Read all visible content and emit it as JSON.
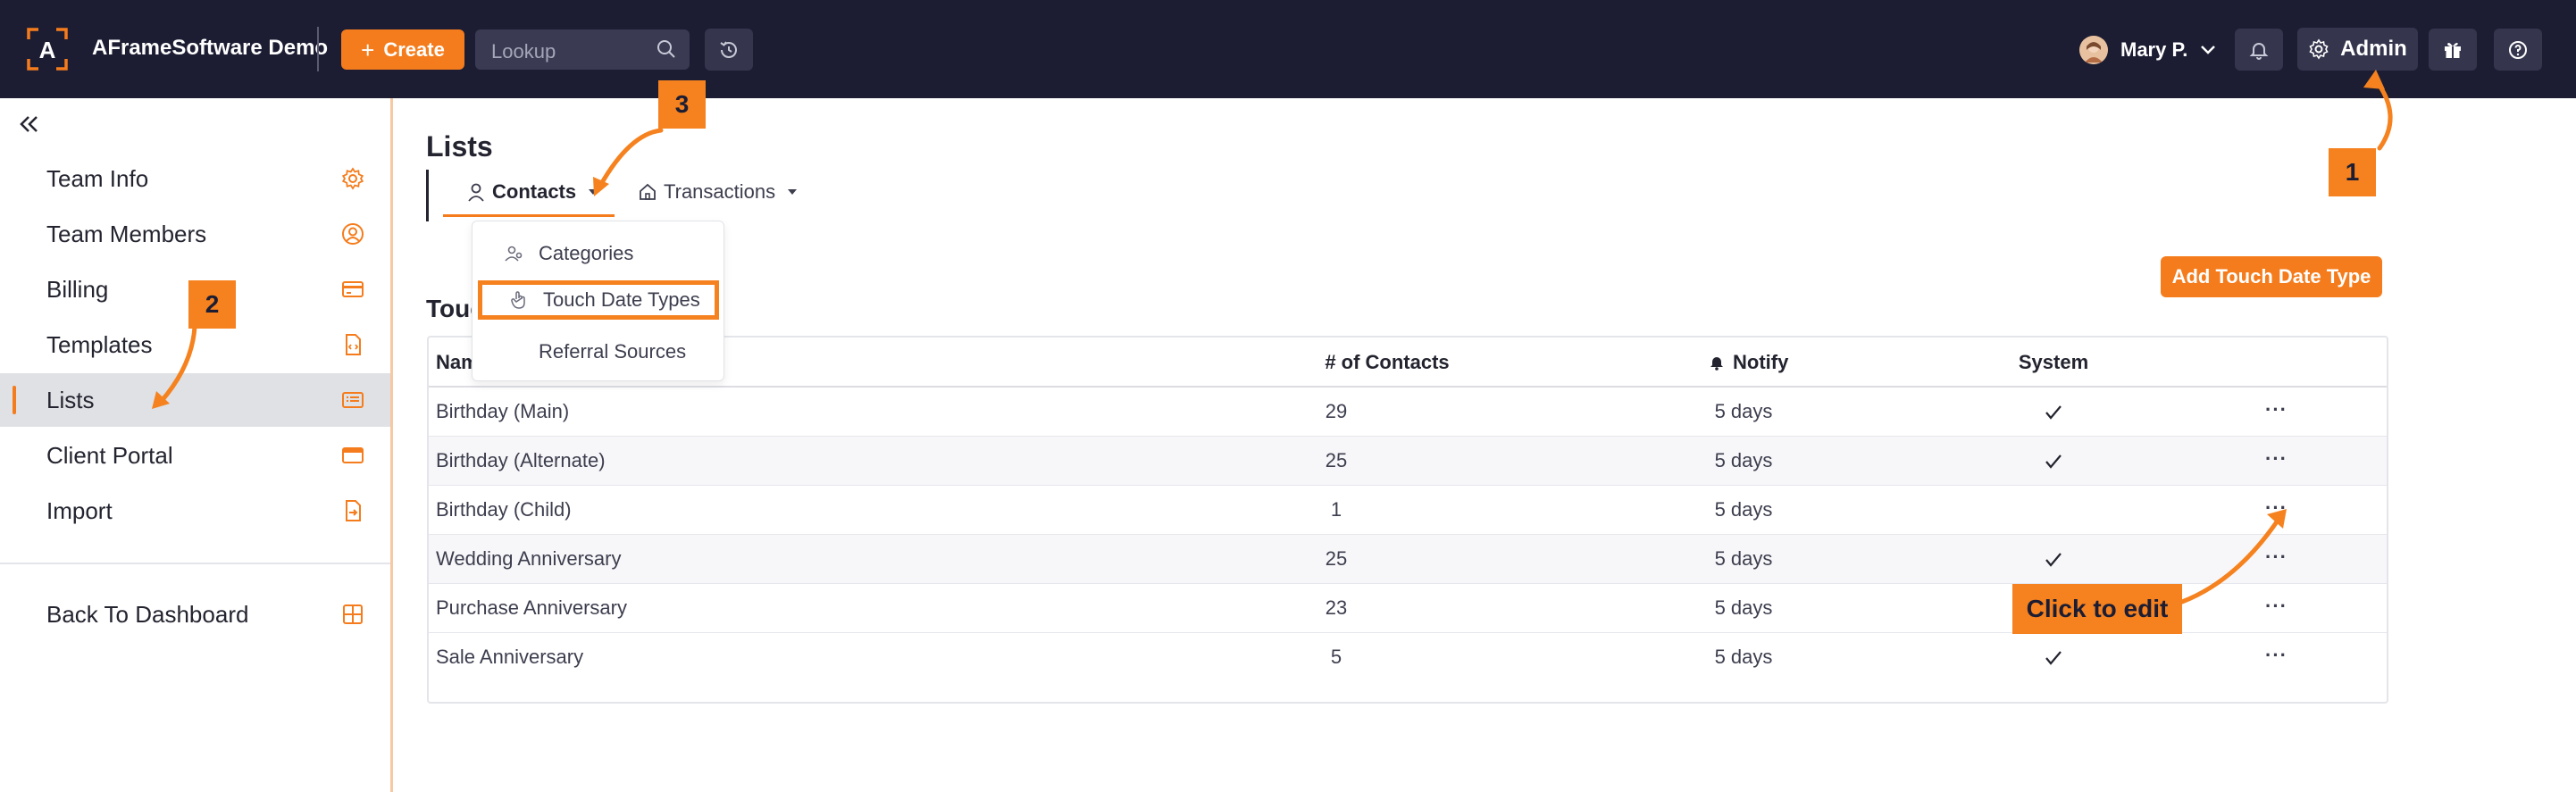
{
  "header": {
    "brand": "AFrameSoftware Demo",
    "create_label": "Create",
    "lookup_placeholder": "Lookup",
    "user_name": "Mary P.",
    "admin_label": "Admin"
  },
  "sidebar": {
    "items": [
      {
        "label": "Team Info",
        "icon": "gear-icon"
      },
      {
        "label": "Team Members",
        "icon": "user-circle-icon"
      },
      {
        "label": "Billing",
        "icon": "credit-card-icon"
      },
      {
        "label": "Templates",
        "icon": "file-code-icon"
      },
      {
        "label": "Lists",
        "icon": "list-icon",
        "active": true
      },
      {
        "label": "Client Portal",
        "icon": "browser-icon"
      },
      {
        "label": "Import",
        "icon": "file-import-icon"
      }
    ],
    "back_label": "Back To Dashboard"
  },
  "main": {
    "title": "Lists",
    "tabs": [
      {
        "label": "Contacts",
        "active": true
      },
      {
        "label": "Transactions"
      }
    ],
    "dropdown": [
      {
        "label": "Categories"
      },
      {
        "label": "Touch Date Types",
        "highlighted": true
      },
      {
        "label": "Referral Sources"
      }
    ],
    "section_title": "Touch Date Types",
    "add_button": "Add Touch Date Type",
    "table": {
      "headers": {
        "name": "Name",
        "contacts": "# of Contacts",
        "notify": "Notify",
        "system": "System"
      },
      "rows": [
        {
          "name": "Birthday (Main)",
          "contacts": "29",
          "notify": "5 days",
          "system": true
        },
        {
          "name": "Birthday (Alternate)",
          "contacts": "25",
          "notify": "5 days",
          "system": true
        },
        {
          "name": "Birthday (Child)",
          "contacts": "1",
          "notify": "5 days",
          "system": false
        },
        {
          "name": "Wedding Anniversary",
          "contacts": "25",
          "notify": "5 days",
          "system": true
        },
        {
          "name": "Purchase Anniversary",
          "contacts": "23",
          "notify": "5 days",
          "system": true
        },
        {
          "name": "Sale Anniversary",
          "contacts": "5",
          "notify": "5 days",
          "system": true
        }
      ],
      "more_glyph": "···"
    }
  },
  "annotations": {
    "step1": "1",
    "step2": "2",
    "step3": "3",
    "callout": "Click to edit"
  },
  "colors": {
    "topbar": "#1c1d33",
    "accent": "#f57c1c",
    "annotation": "#f5821f"
  }
}
